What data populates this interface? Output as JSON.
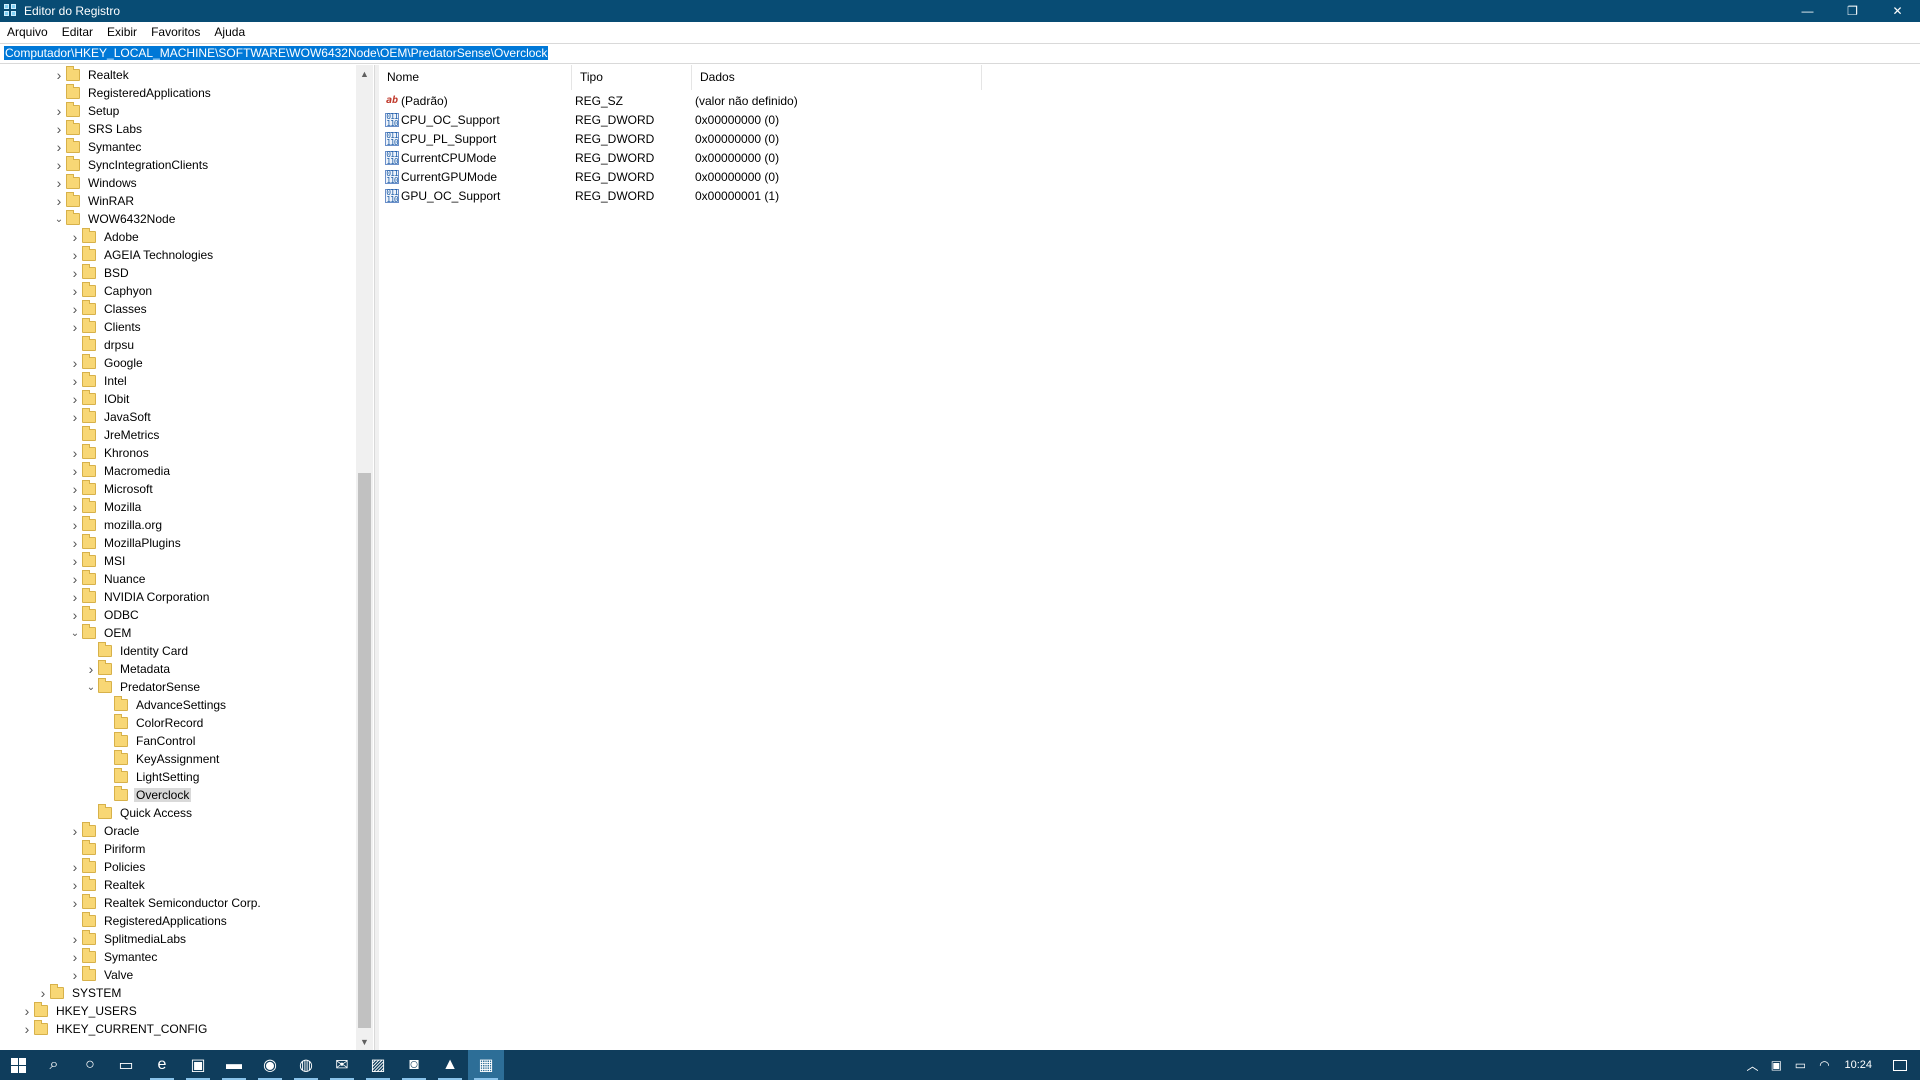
{
  "window": {
    "title": "Editor do Registro",
    "minimize": "—",
    "restore": "❐",
    "close": "✕"
  },
  "menu": [
    "Arquivo",
    "Editar",
    "Exibir",
    "Favoritos",
    "Ajuda"
  ],
  "address": "Computador\\HKEY_LOCAL_MACHINE\\SOFTWARE\\WOW6432Node\\OEM\\PredatorSense\\Overclock",
  "tree": [
    {
      "label": "Realtek",
      "level": 3,
      "exp": ">"
    },
    {
      "label": "RegisteredApplications",
      "level": 3,
      "exp": ""
    },
    {
      "label": "Setup",
      "level": 3,
      "exp": ">"
    },
    {
      "label": "SRS Labs",
      "level": 3,
      "exp": ">"
    },
    {
      "label": "Symantec",
      "level": 3,
      "exp": ">"
    },
    {
      "label": "SyncIntegrationClients",
      "level": 3,
      "exp": ">"
    },
    {
      "label": "Windows",
      "level": 3,
      "exp": ">"
    },
    {
      "label": "WinRAR",
      "level": 3,
      "exp": ">"
    },
    {
      "label": "WOW6432Node",
      "level": 3,
      "exp": "v"
    },
    {
      "label": "Adobe",
      "level": 4,
      "exp": ">"
    },
    {
      "label": "AGEIA Technologies",
      "level": 4,
      "exp": ">"
    },
    {
      "label": "BSD",
      "level": 4,
      "exp": ">"
    },
    {
      "label": "Caphyon",
      "level": 4,
      "exp": ">"
    },
    {
      "label": "Classes",
      "level": 4,
      "exp": ">"
    },
    {
      "label": "Clients",
      "level": 4,
      "exp": ">"
    },
    {
      "label": "drpsu",
      "level": 4,
      "exp": ""
    },
    {
      "label": "Google",
      "level": 4,
      "exp": ">"
    },
    {
      "label": "Intel",
      "level": 4,
      "exp": ">"
    },
    {
      "label": "IObit",
      "level": 4,
      "exp": ">"
    },
    {
      "label": "JavaSoft",
      "level": 4,
      "exp": ">"
    },
    {
      "label": "JreMetrics",
      "level": 4,
      "exp": ""
    },
    {
      "label": "Khronos",
      "level": 4,
      "exp": ">"
    },
    {
      "label": "Macromedia",
      "level": 4,
      "exp": ">"
    },
    {
      "label": "Microsoft",
      "level": 4,
      "exp": ">"
    },
    {
      "label": "Mozilla",
      "level": 4,
      "exp": ">"
    },
    {
      "label": "mozilla.org",
      "level": 4,
      "exp": ">"
    },
    {
      "label": "MozillaPlugins",
      "level": 4,
      "exp": ">"
    },
    {
      "label": "MSI",
      "level": 4,
      "exp": ">"
    },
    {
      "label": "Nuance",
      "level": 4,
      "exp": ">"
    },
    {
      "label": "NVIDIA Corporation",
      "level": 4,
      "exp": ">"
    },
    {
      "label": "ODBC",
      "level": 4,
      "exp": ">"
    },
    {
      "label": "OEM",
      "level": 4,
      "exp": "v"
    },
    {
      "label": "Identity Card",
      "level": 5,
      "exp": ""
    },
    {
      "label": "Metadata",
      "level": 5,
      "exp": ">"
    },
    {
      "label": "PredatorSense",
      "level": 5,
      "exp": "v"
    },
    {
      "label": "AdvanceSettings",
      "level": 6,
      "exp": ""
    },
    {
      "label": "ColorRecord",
      "level": 6,
      "exp": ""
    },
    {
      "label": "FanControl",
      "level": 6,
      "exp": ""
    },
    {
      "label": "KeyAssignment",
      "level": 6,
      "exp": ""
    },
    {
      "label": "LightSetting",
      "level": 6,
      "exp": ""
    },
    {
      "label": "Overclock",
      "level": 6,
      "exp": "",
      "selected": true
    },
    {
      "label": "Quick Access",
      "level": 5,
      "exp": ""
    },
    {
      "label": "Oracle",
      "level": 4,
      "exp": ">"
    },
    {
      "label": "Piriform",
      "level": 4,
      "exp": ""
    },
    {
      "label": "Policies",
      "level": 4,
      "exp": ">"
    },
    {
      "label": "Realtek",
      "level": 4,
      "exp": ">"
    },
    {
      "label": "Realtek Semiconductor Corp.",
      "level": 4,
      "exp": ">"
    },
    {
      "label": "RegisteredApplications",
      "level": 4,
      "exp": ""
    },
    {
      "label": "SplitmediaLabs",
      "level": 4,
      "exp": ">"
    },
    {
      "label": "Symantec",
      "level": 4,
      "exp": ">"
    },
    {
      "label": "Valve",
      "level": 4,
      "exp": ">"
    },
    {
      "label": "SYSTEM",
      "level": 2,
      "exp": ">"
    },
    {
      "label": "HKEY_USERS",
      "level": 1,
      "exp": ">"
    },
    {
      "label": "HKEY_CURRENT_CONFIG",
      "level": 1,
      "exp": ">"
    }
  ],
  "values": {
    "headers": [
      "Nome",
      "Tipo",
      "Dados"
    ],
    "rows": [
      {
        "name": "(Padrão)",
        "type": "REG_SZ",
        "data": "(valor não definido)",
        "icon": "string-value-icon"
      },
      {
        "name": "CPU_OC_Support",
        "type": "REG_DWORD",
        "data": "0x00000000 (0)",
        "icon": "dword-value-icon"
      },
      {
        "name": "CPU_PL_Support",
        "type": "REG_DWORD",
        "data": "0x00000000 (0)",
        "icon": "dword-value-icon"
      },
      {
        "name": "CurrentCPUMode",
        "type": "REG_DWORD",
        "data": "0x00000000 (0)",
        "icon": "dword-value-icon"
      },
      {
        "name": "CurrentGPUMode",
        "type": "REG_DWORD",
        "data": "0x00000000 (0)",
        "icon": "dword-value-icon"
      },
      {
        "name": "GPU_OC_Support",
        "type": "REG_DWORD",
        "data": "0x00000001 (1)",
        "icon": "dword-value-icon"
      }
    ]
  },
  "taskbar": {
    "apps": [
      {
        "name": "search-icon",
        "glyph": "⌕"
      },
      {
        "name": "cortana-icon",
        "glyph": "○"
      },
      {
        "name": "task-view-icon",
        "glyph": "▭"
      },
      {
        "name": "edge-icon",
        "glyph": "e"
      },
      {
        "name": "store-icon",
        "glyph": "▣"
      },
      {
        "name": "file-explorer-icon",
        "glyph": "▬"
      },
      {
        "name": "media-player-icon",
        "glyph": "◉"
      },
      {
        "name": "chrome-icon",
        "glyph": "◍"
      },
      {
        "name": "mail-icon",
        "glyph": "✉"
      },
      {
        "name": "photos-icon",
        "glyph": "▨"
      },
      {
        "name": "whatsapp-icon",
        "glyph": "◙"
      },
      {
        "name": "acrobat-icon",
        "glyph": "▲"
      },
      {
        "name": "regedit-icon",
        "glyph": "▦"
      }
    ],
    "clock": "10:24"
  },
  "colors": {
    "titlebar": "#084c74",
    "taskbar": "#0f3d5c",
    "selection": "#0078d7",
    "folder": "#f8d775"
  }
}
